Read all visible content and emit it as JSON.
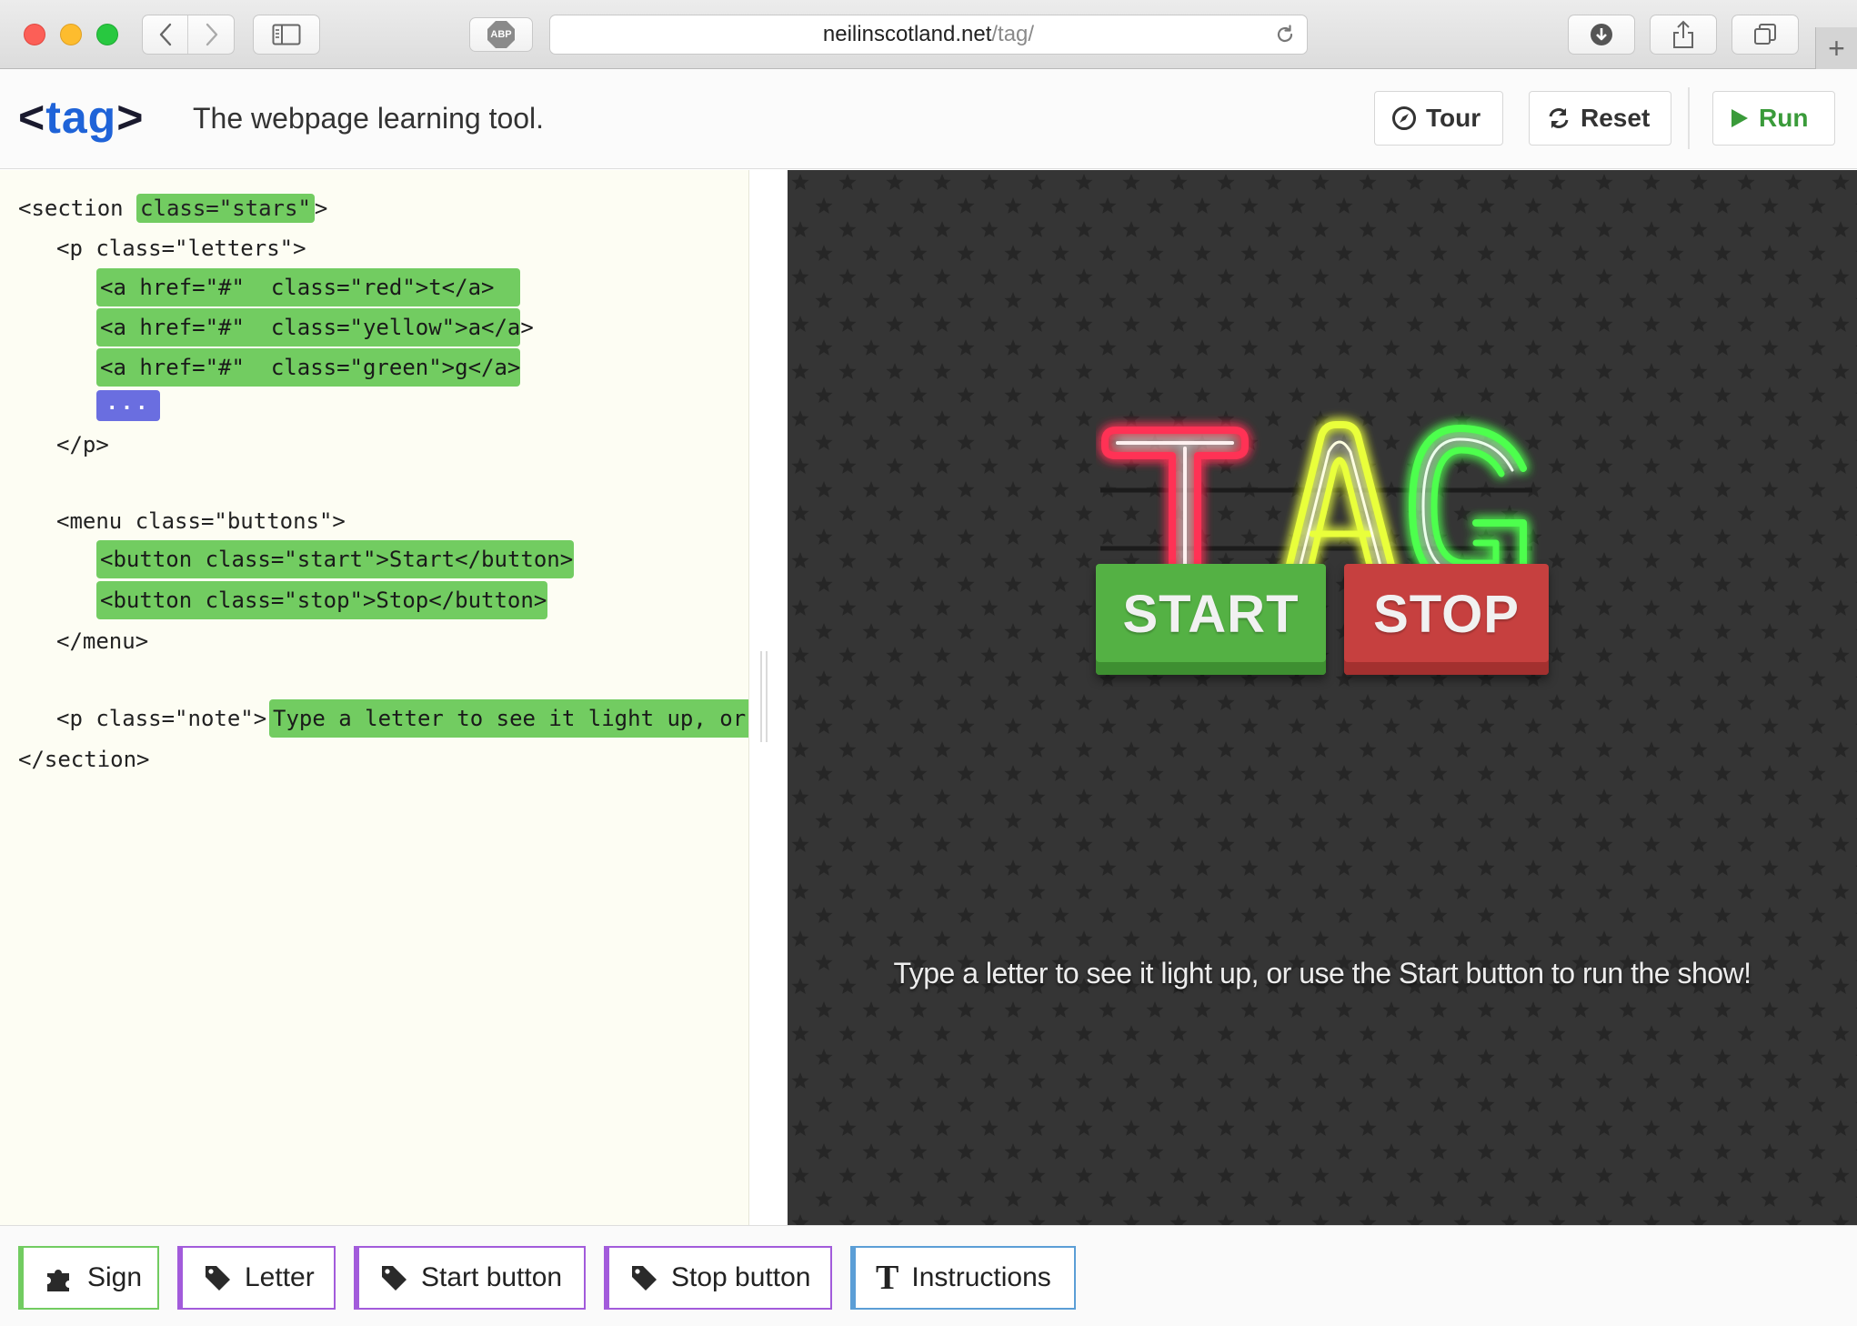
{
  "browser": {
    "url_host": "neilinscotland.net",
    "url_path": "/tag/",
    "adblock_label": "ABP",
    "new_tab_label": "+"
  },
  "header": {
    "logo_open": "<",
    "logo_word": "tag",
    "logo_close": ">",
    "tagline": "The webpage learning tool.",
    "tour_label": "Tour",
    "reset_label": "Reset",
    "run_label": "Run",
    "run_color": "#3a9b3a"
  },
  "editor": {
    "line1": "<section ",
    "line1_hl": "class=\"stars\"",
    "line1_end": ">",
    "line2": "<p class=\"letters\">",
    "block_red": "<a href=\"#\"  class=\"red\">t</a>",
    "block_yellow": "<a href=\"#\"  class=\"yellow\">a</a>",
    "block_green": "<a href=\"#\"  class=\"green\">g</a>",
    "ellipsis": "...",
    "line_p_close": "</p>",
    "line_menu": "<menu class=\"buttons\">",
    "block_start": "<button class=\"start\">Start</button>",
    "block_stop": "<button class=\"stop\">Stop</button>",
    "line_menu_close": "</menu>",
    "line_note_open": "<p class=\"note\">",
    "note_text": "Type a letter to see it light up, or",
    "line_section_close": "</section>",
    "highlight_color": "#72cc61",
    "ellipsis_color": "#6a6ee0"
  },
  "preview": {
    "sign_letters": [
      "T",
      "A",
      "G"
    ],
    "sign_colors": [
      "#ff2a4f",
      "#f3ff4a",
      "#5cff5c"
    ],
    "start_label": "START",
    "stop_label": "STOP",
    "instructions": "Type a letter to see it light up, or use the Start button to run the show!"
  },
  "toolbar": {
    "items": [
      {
        "label": "Sign",
        "icon": "puzzle-icon",
        "color": "#72cc61"
      },
      {
        "label": "Letter",
        "icon": "tag-icon",
        "color": "#a25bdb"
      },
      {
        "label": "Start button",
        "icon": "tag-icon",
        "color": "#a25bdb"
      },
      {
        "label": "Stop button",
        "icon": "tag-icon",
        "color": "#a25bdb"
      },
      {
        "label": "Instructions",
        "icon": "text-icon",
        "color": "#5b9ed6"
      }
    ]
  }
}
